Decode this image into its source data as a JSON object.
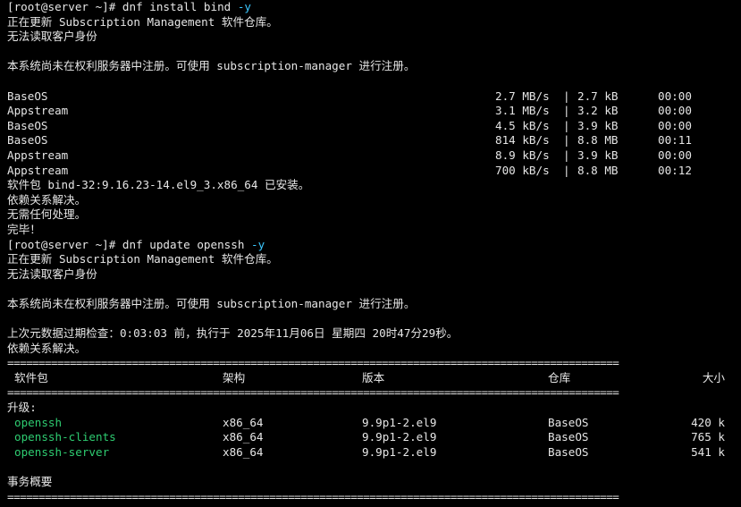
{
  "terminal": {
    "prompt": "[root@server ~]#",
    "cmd1": {
      "text": "dnf install bind",
      "arg": "-y"
    },
    "updating_repo": "正在更新 Subscription Management 软件仓库。",
    "cannot_read_id": "无法读取客户身份",
    "not_registered": "本系统尚未在权利服务器中注册。可使用 subscription-manager 进行注册。",
    "repo_rows": [
      {
        "name": "BaseOS",
        "speed": "2.7 MB/s",
        "size": "2.7 kB",
        "time": "00:00"
      },
      {
        "name": "Appstream",
        "speed": "3.1 MB/s",
        "size": "3.2 kB",
        "time": "00:00"
      },
      {
        "name": "BaseOS",
        "speed": "4.5 kB/s",
        "size": "3.9 kB",
        "time": "00:00"
      },
      {
        "name": "BaseOS",
        "speed": "814 kB/s",
        "size": "8.8 MB",
        "time": "00:11"
      },
      {
        "name": "Appstream",
        "speed": "8.9 kB/s",
        "size": "3.9 kB",
        "time": "00:00"
      },
      {
        "name": "Appstream",
        "speed": "700 kB/s",
        "size": "8.8 MB",
        "time": "00:12"
      }
    ],
    "bind_installed": "软件包 bind-32:9.16.23-14.el9_3.x86_64 已安装。",
    "deps_resolved": "依赖关系解决。",
    "nothing_to_do": "无需任何处理。",
    "complete": "完毕！",
    "cmd2": {
      "text": "dnf update openssh",
      "arg": "-y"
    },
    "metadata_check": "上次元数据过期检查：0:03:03 前，执行于 2025年11月06日 星期四 20时47分29秒。",
    "separator": "==================================================================================================",
    "table_headers": {
      "package": "软件包",
      "arch": "架构",
      "version": "版本",
      "repo": "仓库",
      "size": "大小"
    },
    "upgrade_label": "升级:",
    "packages": [
      {
        "name": "openssh",
        "arch": "x86_64",
        "version": "9.9p1-2.el9",
        "repo": "BaseOS",
        "size": "420 k"
      },
      {
        "name": "openssh-clients",
        "arch": "x86_64",
        "version": "9.9p1-2.el9",
        "repo": "BaseOS",
        "size": "765 k"
      },
      {
        "name": "openssh-server",
        "arch": "x86_64",
        "version": "9.9p1-2.el9",
        "repo": "BaseOS",
        "size": "541 k"
      }
    ],
    "transaction_summary": "事务概要",
    "colors": {
      "background": "#000000",
      "text": "#e6e6e6",
      "arg": "#3bc8ff",
      "package": "#2ecc71"
    }
  }
}
